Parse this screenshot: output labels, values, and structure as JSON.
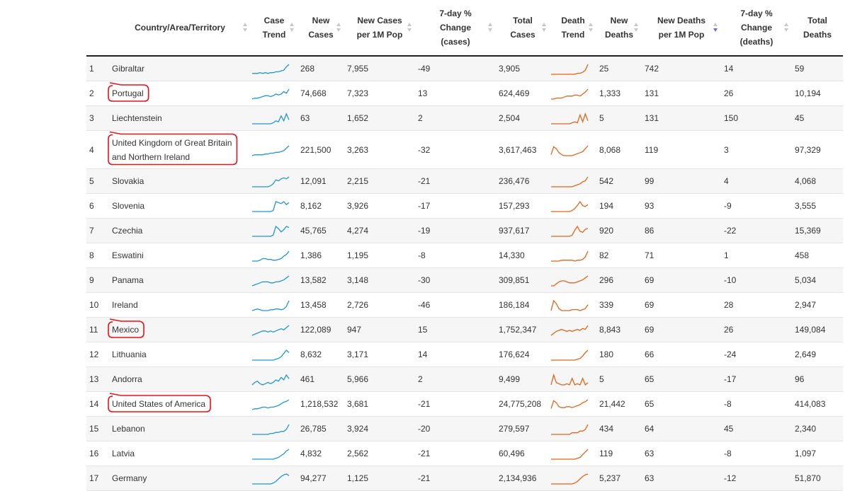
{
  "colors": {
    "case_trend": "#1f97d4",
    "death_trend": "#e0661b",
    "annotation": "#e8141a",
    "sort_active": "#7b68c8"
  },
  "columns": [
    {
      "key": "rank",
      "label": ""
    },
    {
      "key": "country",
      "label": "Country/Area/Territory"
    },
    {
      "key": "case_trend",
      "label": "Case Trend"
    },
    {
      "key": "new_cases",
      "label": "New Cases"
    },
    {
      "key": "new_cases_per_1m",
      "label": "New Cases per 1M Pop"
    },
    {
      "key": "change_cases",
      "label": "7-day % Change (cases)"
    },
    {
      "key": "total_cases",
      "label": "Total Cases"
    },
    {
      "key": "death_trend",
      "label": "Death Trend"
    },
    {
      "key": "new_deaths",
      "label": "New Deaths"
    },
    {
      "key": "new_deaths_per_1m",
      "label": "New Deaths per 1M Pop"
    },
    {
      "key": "change_deaths",
      "label": "7-day % Change (deaths)"
    },
    {
      "key": "total_deaths",
      "label": "Total Deaths"
    }
  ],
  "sorted_column": "new_deaths_per_1m",
  "rows": [
    {
      "rank": "1",
      "country": "Gibraltar",
      "new_cases": "268",
      "per1m": "7,955",
      "chg_cases": "-49",
      "total_cases": "3,905",
      "new_deaths": "25",
      "deaths_per1m": "742",
      "chg_deaths": "14",
      "total_deaths": "59",
      "case_trend": [
        1,
        1,
        1,
        2,
        1,
        2,
        1,
        2,
        2,
        3,
        3,
        4,
        5,
        9,
        12
      ],
      "death_trend": [
        0,
        0,
        0,
        0,
        0,
        0,
        0,
        0,
        0,
        0,
        1,
        1,
        2,
        4,
        10
      ],
      "circled": false
    },
    {
      "rank": "2",
      "country": "Portugal",
      "new_cases": "74,668",
      "per1m": "7,323",
      "chg_cases": "13",
      "total_cases": "624,469",
      "new_deaths": "1,333",
      "deaths_per1m": "131",
      "chg_deaths": "26",
      "total_deaths": "10,194",
      "case_trend": [
        0,
        1,
        1,
        2,
        3,
        4,
        4,
        3,
        4,
        6,
        5,
        6,
        9,
        7,
        12
      ],
      "death_trend": [
        0,
        0,
        1,
        1,
        1,
        2,
        3,
        3,
        3,
        4,
        4,
        3,
        5,
        7,
        10
      ],
      "circled": true
    },
    {
      "rank": "3",
      "country": "Liechtenstein",
      "new_cases": "63",
      "per1m": "1,652",
      "chg_cases": "2",
      "total_cases": "2,504",
      "new_deaths": "5",
      "deaths_per1m": "131",
      "chg_deaths": "150",
      "total_deaths": "45",
      "case_trend": [
        0,
        0,
        0,
        0,
        0,
        0,
        0,
        0,
        1,
        3,
        2,
        8,
        3,
        10,
        4
      ],
      "death_trend": [
        0,
        0,
        0,
        0,
        0,
        0,
        0,
        0,
        1,
        2,
        1,
        9,
        2,
        10,
        3
      ],
      "circled": false
    },
    {
      "rank": "4",
      "country": "United Kingdom of Great Britain and Northern Ireland",
      "new_cases": "221,500",
      "per1m": "3,263",
      "chg_cases": "-32",
      "total_cases": "3,617,463",
      "new_deaths": "8,068",
      "deaths_per1m": "119",
      "chg_deaths": "3",
      "total_deaths": "97,329",
      "case_trend": [
        0,
        1,
        1,
        1,
        1,
        2,
        2,
        3,
        3,
        4,
        4,
        5,
        6,
        9,
        12
      ],
      "death_trend": [
        1,
        9,
        7,
        3,
        1,
        0,
        0,
        0,
        0,
        1,
        2,
        3,
        4,
        7,
        10
      ],
      "circled": true
    },
    {
      "rank": "5",
      "country": "Slovakia",
      "new_cases": "12,091",
      "per1m": "2,215",
      "chg_cases": "-21",
      "total_cases": "236,476",
      "new_deaths": "542",
      "deaths_per1m": "99",
      "chg_deaths": "4",
      "total_deaths": "4,068",
      "case_trend": [
        0,
        0,
        0,
        0,
        0,
        0,
        0,
        1,
        3,
        7,
        6,
        8,
        9,
        8,
        10
      ],
      "death_trend": [
        0,
        0,
        0,
        0,
        0,
        0,
        0,
        0,
        0,
        1,
        2,
        3,
        5,
        6,
        10
      ],
      "circled": false
    },
    {
      "rank": "6",
      "country": "Slovenia",
      "new_cases": "8,162",
      "per1m": "3,926",
      "chg_cases": "-17",
      "total_cases": "157,293",
      "new_deaths": "194",
      "deaths_per1m": "93",
      "chg_deaths": "-9",
      "total_deaths": "3,555",
      "case_trend": [
        0,
        0,
        0,
        0,
        0,
        0,
        0,
        0,
        1,
        10,
        9,
        8,
        10,
        7,
        9
      ],
      "death_trend": [
        0,
        0,
        0,
        0,
        0,
        0,
        0,
        0,
        1,
        3,
        6,
        10,
        6,
        5,
        7
      ],
      "circled": false
    },
    {
      "rank": "7",
      "country": "Czechia",
      "new_cases": "45,765",
      "per1m": "4,274",
      "chg_cases": "-19",
      "total_cases": "937,617",
      "new_deaths": "920",
      "deaths_per1m": "86",
      "chg_deaths": "-22",
      "total_deaths": "15,369",
      "case_trend": [
        0,
        0,
        0,
        0,
        0,
        0,
        0,
        0,
        1,
        9,
        7,
        4,
        6,
        9,
        8
      ],
      "death_trend": [
        0,
        0,
        0,
        0,
        0,
        0,
        0,
        0,
        1,
        6,
        10,
        5,
        4,
        7,
        8
      ],
      "circled": false
    },
    {
      "rank": "8",
      "country": "Eswatini",
      "new_cases": "1,386",
      "per1m": "1,195",
      "chg_cases": "-8",
      "total_cases": "14,330",
      "new_deaths": "82",
      "deaths_per1m": "71",
      "chg_deaths": "1",
      "total_deaths": "458",
      "case_trend": [
        0,
        0,
        0,
        1,
        3,
        3,
        2,
        2,
        1,
        1,
        2,
        3,
        6,
        8,
        12
      ],
      "death_trend": [
        0,
        0,
        0,
        0,
        1,
        1,
        1,
        1,
        1,
        0,
        1,
        1,
        2,
        5,
        12
      ],
      "circled": false
    },
    {
      "rank": "9",
      "country": "Panama",
      "new_cases": "13,582",
      "per1m": "3,148",
      "chg_cases": "-30",
      "total_cases": "309,851",
      "new_deaths": "296",
      "deaths_per1m": "69",
      "chg_deaths": "-10",
      "total_deaths": "5,034",
      "case_trend": [
        0,
        1,
        2,
        3,
        4,
        4,
        4,
        3,
        3,
        4,
        4,
        5,
        6,
        8,
        10
      ],
      "death_trend": [
        0,
        0,
        2,
        4,
        5,
        5,
        4,
        3,
        3,
        3,
        4,
        5,
        6,
        8,
        10
      ],
      "circled": false
    },
    {
      "rank": "10",
      "country": "Ireland",
      "new_cases": "13,458",
      "per1m": "2,726",
      "chg_cases": "-46",
      "total_cases": "186,184",
      "new_deaths": "339",
      "deaths_per1m": "69",
      "chg_deaths": "28",
      "total_deaths": "2,947",
      "case_trend": [
        0,
        1,
        2,
        1,
        0,
        0,
        0,
        1,
        1,
        2,
        2,
        1,
        2,
        5,
        12
      ],
      "death_trend": [
        0,
        10,
        7,
        2,
        0,
        0,
        0,
        0,
        1,
        1,
        1,
        0,
        1,
        2,
        6
      ],
      "circled": false
    },
    {
      "rank": "11",
      "country": "Mexico",
      "new_cases": "122,089",
      "per1m": "947",
      "chg_cases": "15",
      "total_cases": "1,752,347",
      "new_deaths": "8,843",
      "deaths_per1m": "69",
      "chg_deaths": "26",
      "total_deaths": "149,084",
      "case_trend": [
        0,
        1,
        2,
        3,
        4,
        4,
        3,
        4,
        3,
        4,
        5,
        6,
        5,
        7,
        9
      ],
      "death_trend": [
        0,
        2,
        4,
        5,
        6,
        5,
        4,
        5,
        4,
        5,
        6,
        5,
        7,
        6,
        10
      ],
      "circled": true
    },
    {
      "rank": "12",
      "country": "Lithuania",
      "new_cases": "8,632",
      "per1m": "3,171",
      "chg_cases": "14",
      "total_cases": "176,624",
      "new_deaths": "180",
      "deaths_per1m": "66",
      "chg_deaths": "-24",
      "total_deaths": "2,649",
      "case_trend": [
        0,
        0,
        0,
        0,
        0,
        0,
        0,
        0,
        0,
        1,
        2,
        4,
        8,
        12,
        9
      ],
      "death_trend": [
        0,
        0,
        0,
        0,
        0,
        0,
        0,
        0,
        0,
        0,
        1,
        2,
        5,
        9,
        12
      ],
      "circled": false
    },
    {
      "rank": "13",
      "country": "Andorra",
      "new_cases": "461",
      "per1m": "5,966",
      "chg_cases": "2",
      "total_cases": "9,499",
      "new_deaths": "5",
      "deaths_per1m": "65",
      "chg_deaths": "-17",
      "total_deaths": "96",
      "case_trend": [
        0,
        2,
        3,
        1,
        0,
        1,
        2,
        1,
        2,
        4,
        3,
        6,
        4,
        8,
        5
      ],
      "death_trend": [
        0,
        9,
        2,
        1,
        0,
        0,
        1,
        0,
        6,
        0,
        1,
        0,
        6,
        0,
        2
      ],
      "circled": false
    },
    {
      "rank": "14",
      "country": "United States of America",
      "new_cases": "1,218,532",
      "per1m": "3,681",
      "chg_cases": "-21",
      "total_cases": "24,775,208",
      "new_deaths": "21,442",
      "deaths_per1m": "65",
      "chg_deaths": "-8",
      "total_deaths": "414,083",
      "case_trend": [
        0,
        1,
        1,
        2,
        3,
        3,
        2,
        3,
        3,
        4,
        5,
        7,
        9,
        10,
        12
      ],
      "death_trend": [
        1,
        9,
        7,
        3,
        2,
        2,
        3,
        3,
        2,
        3,
        4,
        5,
        7,
        8,
        10
      ],
      "circled": true
    },
    {
      "rank": "15",
      "country": "Lebanon",
      "new_cases": "26,785",
      "per1m": "3,924",
      "chg_cases": "-20",
      "total_cases": "279,597",
      "new_deaths": "434",
      "deaths_per1m": "64",
      "chg_deaths": "45",
      "total_deaths": "2,340",
      "case_trend": [
        0,
        0,
        0,
        0,
        0,
        0,
        0,
        1,
        1,
        2,
        2,
        3,
        3,
        5,
        10
      ],
      "death_trend": [
        0,
        0,
        0,
        0,
        0,
        0,
        0,
        0,
        1,
        1,
        1,
        2,
        2,
        3,
        6
      ],
      "circled": false
    },
    {
      "rank": "16",
      "country": "Latvia",
      "new_cases": "4,832",
      "per1m": "2,562",
      "chg_cases": "-21",
      "total_cases": "60,496",
      "new_deaths": "119",
      "deaths_per1m": "63",
      "chg_deaths": "-8",
      "total_deaths": "1,097",
      "case_trend": [
        0,
        0,
        0,
        0,
        0,
        0,
        0,
        0,
        0,
        1,
        2,
        4,
        6,
        9,
        11
      ],
      "death_trend": [
        0,
        0,
        0,
        0,
        0,
        0,
        0,
        0,
        0,
        0,
        1,
        2,
        5,
        8,
        11
      ],
      "circled": false
    },
    {
      "rank": "17",
      "country": "Germany",
      "new_cases": "94,277",
      "per1m": "1,125",
      "chg_cases": "-21",
      "total_cases": "2,134,936",
      "new_deaths": "5,237",
      "deaths_per1m": "63",
      "chg_deaths": "-12",
      "total_deaths": "51,870",
      "case_trend": [
        0,
        0,
        0,
        0,
        0,
        0,
        0,
        0,
        1,
        3,
        6,
        9,
        11,
        12,
        10
      ],
      "death_trend": [
        0,
        0,
        0,
        0,
        0,
        0,
        0,
        0,
        0,
        1,
        3,
        6,
        9,
        11,
        12
      ],
      "circled": false
    }
  ]
}
